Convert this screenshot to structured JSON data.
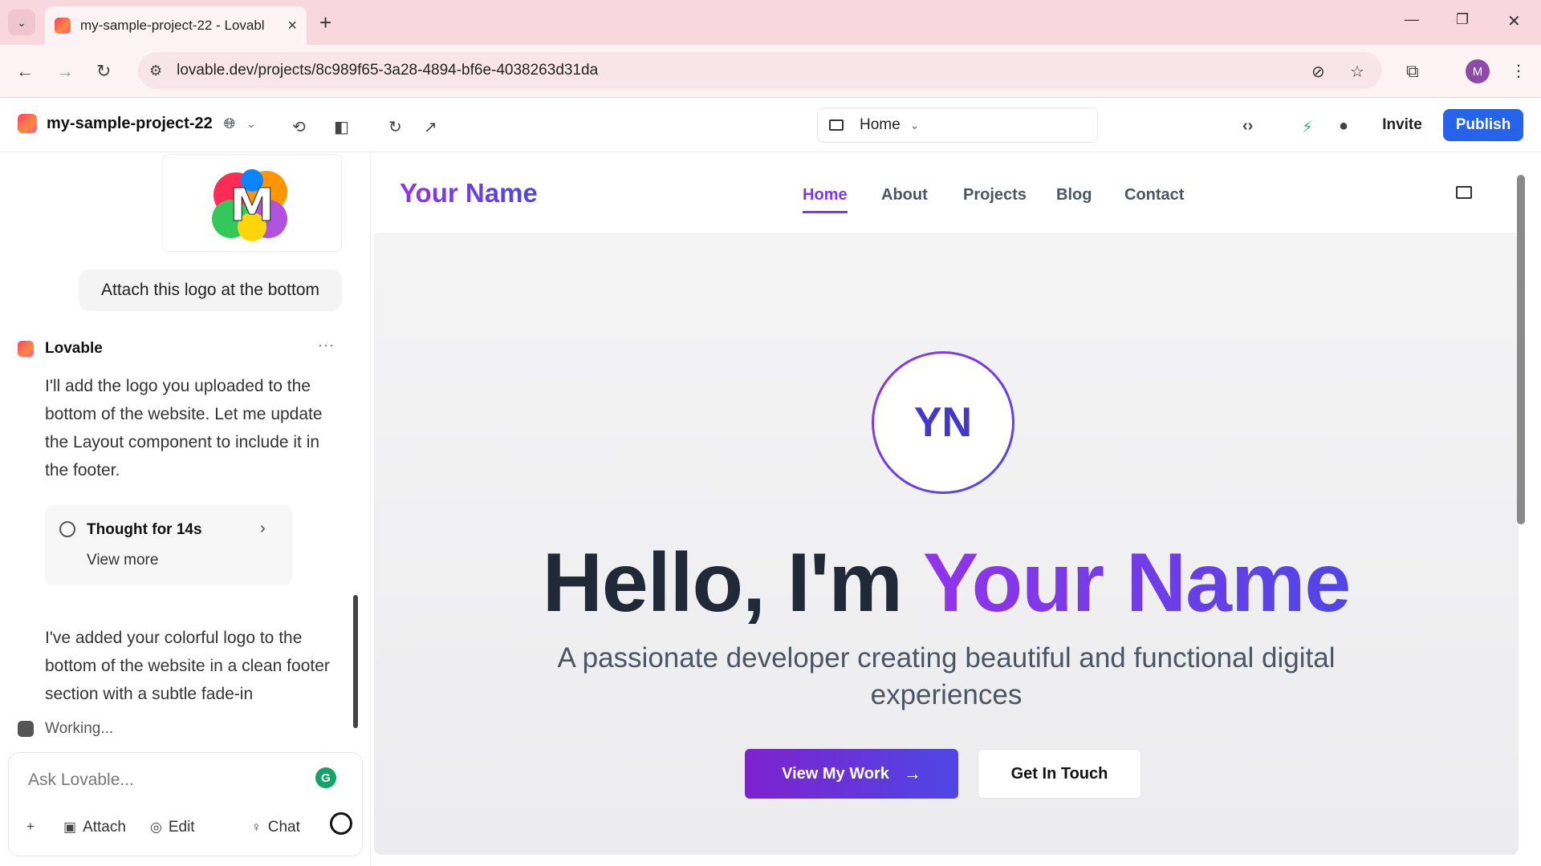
{
  "browser": {
    "tab_title": "my-sample-project-22 - Lovabl",
    "url": "lovable.dev/projects/8c989f65-3a28-4894-bf6e-4038263d31da",
    "profile_initial": "M",
    "icons": [
      "tab-list-icon",
      "close-icon",
      "new-tab-icon",
      "minimize-icon",
      "restore-icon",
      "window-close-icon",
      "back-icon",
      "forward-icon",
      "reload-icon",
      "site-info-icon",
      "eye-off-icon",
      "star-icon",
      "extensions-icon",
      "kebab-menu-icon"
    ]
  },
  "appbar": {
    "project_name": "my-sample-project-22",
    "page_selector": "Home",
    "invite_label": "Invite",
    "publish_label": "Publish",
    "accent_color": "#2563eb"
  },
  "chat": {
    "user_message": "Attach this logo at the bottom",
    "assistant_name": "Lovable",
    "assistant_message_1": "I'll add the logo you uploaded to the bottom of the website. Let me update the Layout component to include it in the footer.",
    "thought_title": "Thought for 14s",
    "thought_more": "View more",
    "assistant_message_2": "I've added your colorful logo to the bottom of the website in a clean footer section with a subtle fade-in",
    "status": "Working...",
    "composer_placeholder": "Ask Lovable...",
    "attach_label": "Attach",
    "edit_label": "Edit",
    "chat_label": "Chat",
    "logo_letter": "M"
  },
  "preview": {
    "brand": "Your Name",
    "nav": [
      "Home",
      "About",
      "Projects",
      "Blog",
      "Contact"
    ],
    "active_nav": "Home",
    "avatar_initials": "YN",
    "headline_plain": "Hello, I'm ",
    "headline_highlight": "Your Name",
    "subline": "A passionate developer creating beautiful and functional digital experiences",
    "primary_button": "View My Work",
    "secondary_button": "Get In Touch",
    "brand_gradient": [
      "#9333ea",
      "#4f46e5"
    ]
  }
}
